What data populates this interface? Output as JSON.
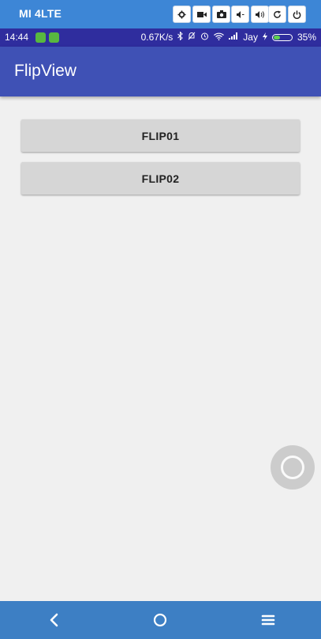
{
  "emulator": {
    "device_name": "MI 4LTE",
    "controls": [
      {
        "icon": "gear-icon"
      },
      {
        "icon": "video-camera-icon"
      },
      {
        "icon": "camera-icon"
      },
      {
        "icon": "volume-down-icon"
      },
      {
        "icon": "volume-up-icon"
      },
      {
        "icon": "rotate-icon"
      },
      {
        "icon": "power-icon"
      }
    ]
  },
  "status_bar": {
    "time": "14:44",
    "network_speed": "0.67K/s",
    "carrier": "Jay",
    "battery_percent": "35%",
    "battery_level": 0.35
  },
  "app_bar": {
    "title": "FlipView"
  },
  "main": {
    "buttons": [
      {
        "label": "FLIP01"
      },
      {
        "label": "FLIP02"
      }
    ]
  },
  "nav_bar": {
    "items": [
      {
        "icon": "back-icon"
      },
      {
        "icon": "home-icon"
      },
      {
        "icon": "menu-icon"
      }
    ]
  },
  "colors": {
    "emulator_bar": "#3d86d6",
    "status_bar": "#2f2d9e",
    "app_bar": "#3f51b5",
    "background": "#f0f0f0",
    "button": "#d6d6d6",
    "nav_bar": "#3d7fc4"
  }
}
